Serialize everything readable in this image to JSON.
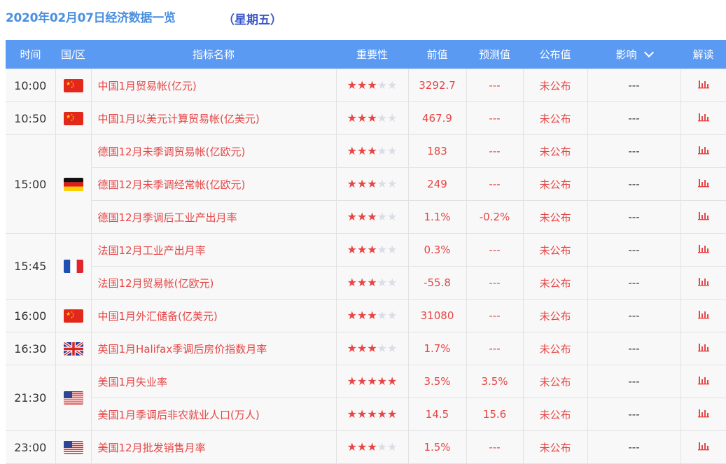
{
  "header": {
    "date_title": "2020年02月07日经济数据一览",
    "weekday": "（星期五）"
  },
  "columns": {
    "time": "时间",
    "region": "国/区",
    "indicator": "指标名称",
    "importance": "重要性",
    "previous": "前值",
    "forecast": "预测值",
    "actual": "公布值",
    "impact": "影响",
    "analysis": "解读"
  },
  "rows": [
    {
      "time": "10:00",
      "flag": "cn",
      "name": "中国1月贸易帐(亿元)",
      "stars": 3,
      "prev": "3292.7",
      "fore": "---",
      "pub": "未公布",
      "impact": "---"
    },
    {
      "time": "10:50",
      "flag": "cn",
      "name": "中国1月以美元计算贸易帐(亿美元)",
      "stars": 3,
      "prev": "467.9",
      "fore": "---",
      "pub": "未公布",
      "impact": "---"
    },
    {
      "time": "15:00",
      "flag": "de",
      "name": "德国12月未季调贸易帐(亿欧元)",
      "stars": 3,
      "prev": "183",
      "fore": "---",
      "pub": "未公布",
      "impact": "---"
    },
    {
      "time": "",
      "flag": "",
      "name": "德国12月未季调经常帐(亿欧元)",
      "stars": 3,
      "prev": "249",
      "fore": "---",
      "pub": "未公布",
      "impact": "---"
    },
    {
      "time": "",
      "flag": "",
      "name": "德国12月季调后工业产出月率",
      "stars": 3,
      "prev": "1.1%",
      "fore": "-0.2%",
      "pub": "未公布",
      "impact": "---"
    },
    {
      "time": "15:45",
      "flag": "fr",
      "name": "法国12月工业产出月率",
      "stars": 3,
      "prev": "0.3%",
      "fore": "---",
      "pub": "未公布",
      "impact": "---"
    },
    {
      "time": "",
      "flag": "",
      "name": "法国12月贸易帐(亿欧元)",
      "stars": 3,
      "prev": "-55.8",
      "fore": "---",
      "pub": "未公布",
      "impact": "---"
    },
    {
      "time": "16:00",
      "flag": "cn",
      "name": "中国1月外汇储备(亿美元)",
      "stars": 3,
      "prev": "31080",
      "fore": "---",
      "pub": "未公布",
      "impact": "---"
    },
    {
      "time": "16:30",
      "flag": "gb",
      "name": "英国1月Halifax季调后房价指数月率",
      "stars": 3,
      "prev": "1.7%",
      "fore": "---",
      "pub": "未公布",
      "impact": "---"
    },
    {
      "time": "21:30",
      "flag": "us",
      "name": "美国1月失业率",
      "stars": 5,
      "prev": "3.5%",
      "fore": "3.5%",
      "pub": "未公布",
      "impact": "---"
    },
    {
      "time": "",
      "flag": "",
      "name": "美国1月季调后非农就业人口(万人)",
      "stars": 5,
      "prev": "14.5",
      "fore": "15.6",
      "pub": "未公布",
      "impact": "---"
    },
    {
      "time": "23:00",
      "flag": "us",
      "name": "美国12月批发销售月率",
      "stars": 3,
      "prev": "1.5%",
      "fore": "---",
      "pub": "未公布",
      "impact": "---"
    }
  ],
  "colors": {
    "header_bg": "#5b9af3",
    "accent_red": "#e64646",
    "title_blue": "#4a8fe0",
    "weekday_blue": "#3d59c7"
  }
}
